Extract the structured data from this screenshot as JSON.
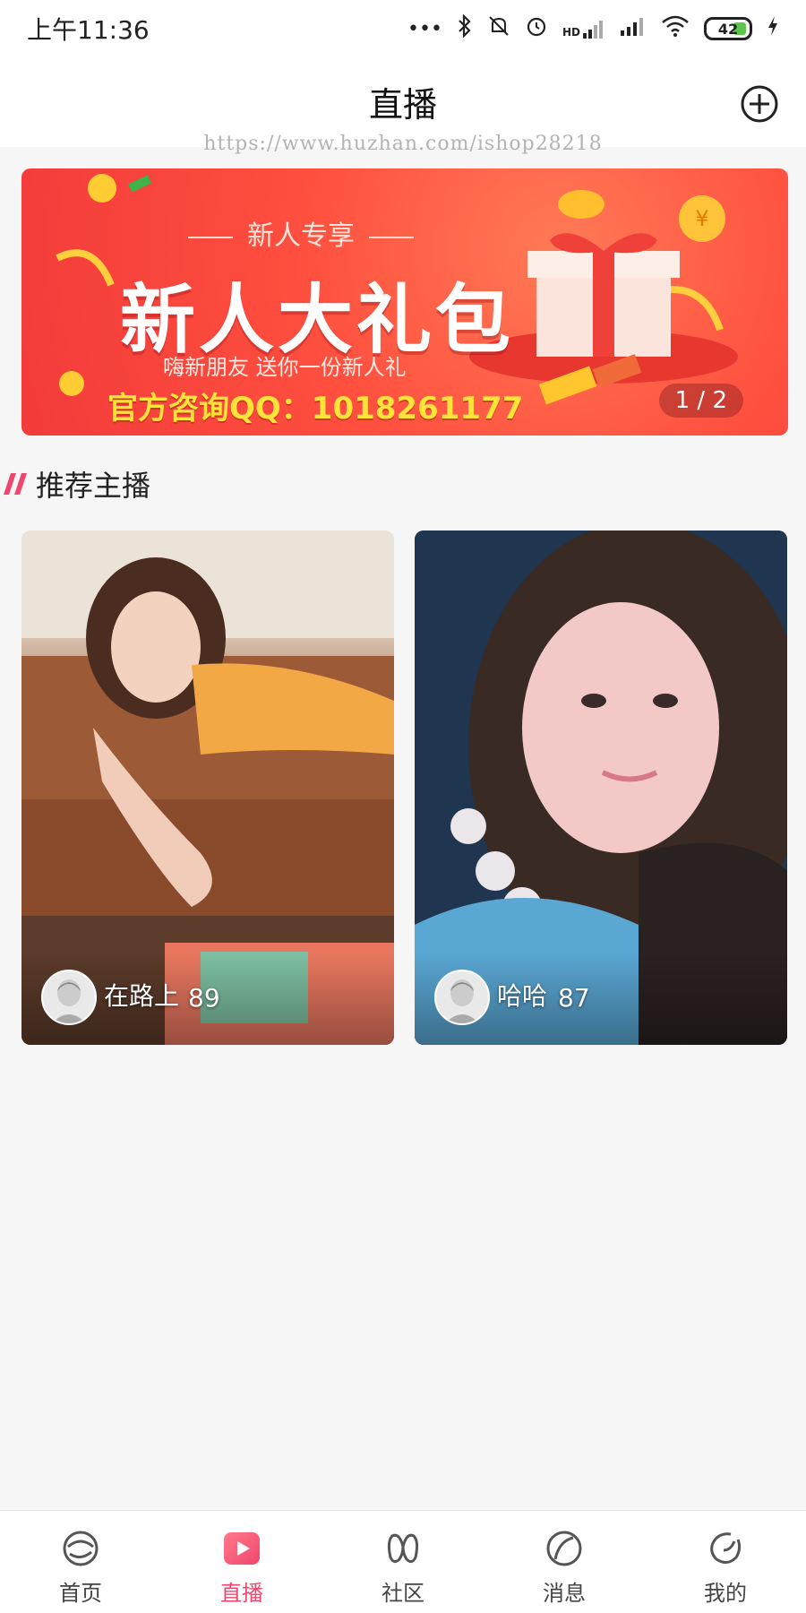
{
  "status_bar": {
    "time": "上午11:36",
    "network_label": "HD",
    "battery": "42",
    "battery_color": "#5cc64a"
  },
  "nav": {
    "title": "直播",
    "add_icon": "plus-circle-icon",
    "watermark": "https://www.huzhan.com/ishop28218"
  },
  "banner": {
    "subtitle": "新人专享",
    "title": "新人大礼包",
    "description": "嗨新朋友 送你一份新人礼",
    "qq": "官方咨询QQ：1018261177",
    "pager": "1 / 2",
    "bg_color": "#f23b3a"
  },
  "section": {
    "title": "推荐主播",
    "accent_color": "#f0466e"
  },
  "streamers": [
    {
      "name": "在路上",
      "count": "89"
    },
    {
      "name": "哈哈",
      "count": "87"
    }
  ],
  "tabs": [
    {
      "label": "首页",
      "icon": "home-swirl-icon",
      "active": false
    },
    {
      "label": "直播",
      "icon": "live-play-icon",
      "active": true
    },
    {
      "label": "社区",
      "icon": "community-icon",
      "active": false
    },
    {
      "label": "消息",
      "icon": "message-icon",
      "active": false
    },
    {
      "label": "我的",
      "icon": "profile-icon",
      "active": false
    }
  ],
  "colors": {
    "active_tab": "#f0466e",
    "inactive_tab": "#444444"
  }
}
